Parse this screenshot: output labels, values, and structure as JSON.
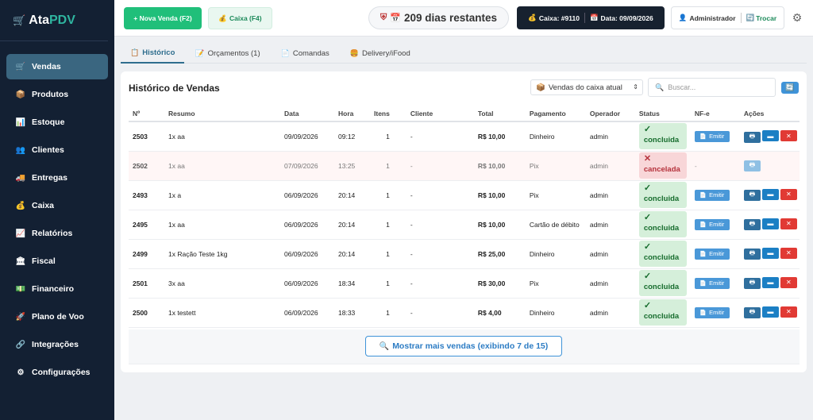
{
  "app": {
    "logo_a": "Ata",
    "logo_b": "PDV"
  },
  "sidebar": {
    "items": [
      {
        "label": "Vendas",
        "icon": "🛒",
        "active": true
      },
      {
        "label": "Produtos",
        "icon": "📦"
      },
      {
        "label": "Estoque",
        "icon": "📊"
      },
      {
        "label": "Clientes",
        "icon": "👥"
      },
      {
        "label": "Entregas",
        "icon": "🚚"
      },
      {
        "label": "Caixa",
        "icon": "💰"
      },
      {
        "label": "Relatórios",
        "icon": "📈"
      },
      {
        "label": "Fiscal",
        "icon": "🏛"
      },
      {
        "label": "Financeiro",
        "icon": "💵"
      },
      {
        "label": "Plano de Voo",
        "icon": "🚀"
      },
      {
        "label": "Integrações",
        "icon": "🔗"
      },
      {
        "label": "Configurações",
        "icon": "⚙"
      }
    ]
  },
  "header": {
    "new_sale": "+ Nova Venda (F2)",
    "caixa_button": "Caixa (F4)",
    "days_remaining": "209 dias restantes",
    "caixa_info": "Caixa: #9110",
    "date_info": "Data: 09/09/2026",
    "user": "Administrador",
    "switch_user": "Trocar"
  },
  "tabs": [
    {
      "label": "Histórico",
      "icon": "📋",
      "active": true
    },
    {
      "label": "Orçamentos (1)",
      "icon": "📝"
    },
    {
      "label": "Comandas",
      "icon": "📄"
    },
    {
      "label": "Delivery/iFood",
      "icon": "🍔"
    }
  ],
  "history": {
    "title": "Histórico de Vendas",
    "filter": "Vendas do caixa atual",
    "search_placeholder": "Buscar...",
    "columns": [
      "Nº",
      "Resumo",
      "Data",
      "Hora",
      "Itens",
      "Cliente",
      "Total",
      "Pagamento",
      "Operador",
      "Status",
      "NF-e",
      "Ações"
    ],
    "rows": [
      {
        "num": "2503",
        "resumo": "1x aa",
        "data": "09/09/2026",
        "hora": "09:12",
        "itens": "1",
        "cliente": "-",
        "total": "R$ 10,00",
        "pagamento": "Dinheiro",
        "operador": "admin",
        "status": "concluida",
        "status_icon": "✓",
        "nfe": "Emitir",
        "cancelled": false
      },
      {
        "num": "2502",
        "resumo": "1x aa",
        "data": "07/09/2026",
        "hora": "13:25",
        "itens": "1",
        "cliente": "-",
        "total": "R$ 10,00",
        "pagamento": "Pix",
        "operador": "admin",
        "status": "cancelada",
        "status_icon": "✕",
        "nfe": "-",
        "cancelled": true
      },
      {
        "num": "2493",
        "resumo": "1x a",
        "data": "06/09/2026",
        "hora": "20:14",
        "itens": "1",
        "cliente": "-",
        "total": "R$ 10,00",
        "pagamento": "Pix",
        "operador": "admin",
        "status": "concluida",
        "status_icon": "✓",
        "nfe": "Emitir",
        "cancelled": false
      },
      {
        "num": "2495",
        "resumo": "1x aa",
        "data": "06/09/2026",
        "hora": "20:14",
        "itens": "1",
        "cliente": "-",
        "total": "R$ 10,00",
        "pagamento": "Cartão de débito",
        "operador": "admin",
        "status": "concluida",
        "status_icon": "✓",
        "nfe": "Emitir",
        "cancelled": false
      },
      {
        "num": "2499",
        "resumo": "1x Ração Teste 1kg",
        "data": "06/09/2026",
        "hora": "20:14",
        "itens": "1",
        "cliente": "-",
        "total": "R$ 25,00",
        "pagamento": "Dinheiro",
        "operador": "admin",
        "status": "concluida",
        "status_icon": "✓",
        "nfe": "Emitir",
        "cancelled": false
      },
      {
        "num": "2501",
        "resumo": "3x aa",
        "data": "06/09/2026",
        "hora": "18:34",
        "itens": "1",
        "cliente": "-",
        "total": "R$ 30,00",
        "pagamento": "Pix",
        "operador": "admin",
        "status": "concluida",
        "status_icon": "✓",
        "nfe": "Emitir",
        "cancelled": false
      },
      {
        "num": "2500",
        "resumo": "1x testett",
        "data": "06/09/2026",
        "hora": "18:33",
        "itens": "1",
        "cliente": "-",
        "total": "R$ 4,00",
        "pagamento": "Dinheiro",
        "operador": "admin",
        "status": "concluida",
        "status_icon": "✓",
        "nfe": "Emitir",
        "cancelled": false
      }
    ],
    "show_more": "Mostrar mais vendas (exibindo 7 de 15)"
  },
  "colors": {
    "accent": "#20bf7a",
    "sidebar_bg": "#132033",
    "active_nav": "#3a6680",
    "brand_teal": "#2fb5a0",
    "primary_blue": "#3f93d8",
    "danger": "#e13a34"
  },
  "icons": {
    "refresh": "refresh-icon",
    "search": "search-icon",
    "gear": "gear-icon",
    "print": "printer-icon",
    "payment": "card-icon",
    "delete": "close-icon"
  }
}
